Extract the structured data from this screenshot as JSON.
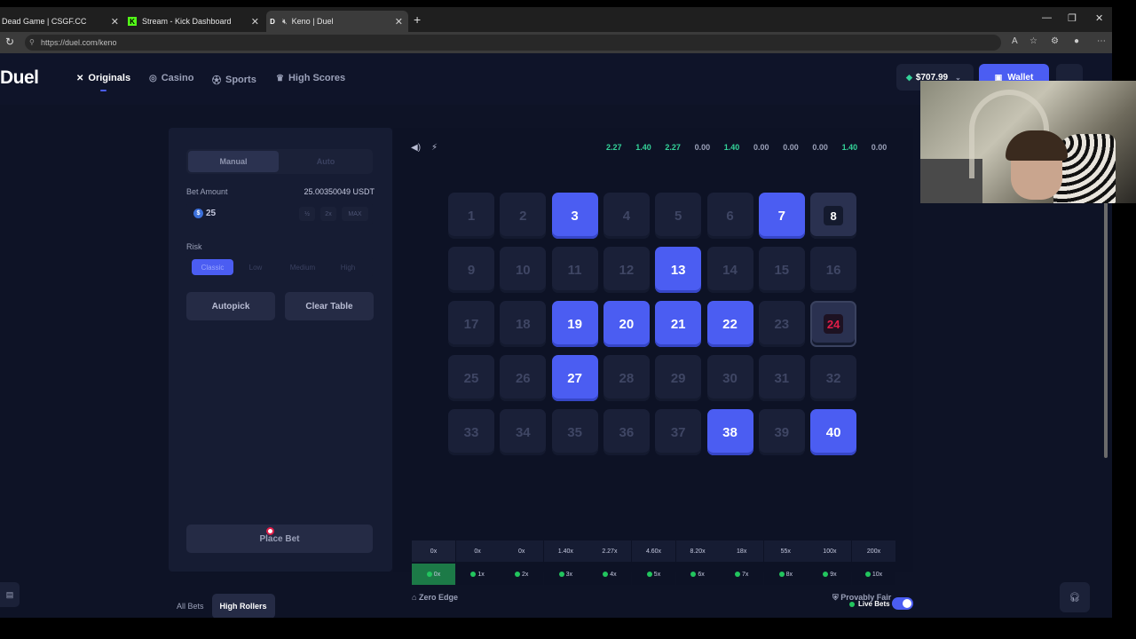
{
  "browser": {
    "tabs": [
      {
        "title": "Dead Game | CSGF.CC",
        "icon": "csgf-icon",
        "active": false
      },
      {
        "title": "Stream - Kick Dashboard",
        "icon": "kick-icon",
        "active": false
      },
      {
        "title": "Keno | Duel",
        "icon": "duel-icon",
        "active": true
      }
    ],
    "new_tab": "+",
    "url": "https://duel.com/keno"
  },
  "header": {
    "logo": "Duel",
    "nav": [
      {
        "label": "Originals",
        "icon": "originals-icon"
      },
      {
        "label": "Casino",
        "icon": "casino-icon"
      },
      {
        "label": "Sports",
        "icon": "sports-icon"
      },
      {
        "label": "High Scores",
        "icon": "trophy-icon"
      }
    ],
    "balance": "$707.99",
    "wallet_label": "Wallet"
  },
  "panel": {
    "mode_manual": "Manual",
    "mode_auto": "Auto",
    "bet_amount_label": "Bet Amount",
    "bet_amount_value": "25.00350049 USDT",
    "bet_input": "25",
    "quick_half": "½",
    "quick_double": "2x",
    "quick_max": "MAX",
    "risk_label": "Risk",
    "risk_options": [
      "Classic",
      "Low",
      "Medium",
      "High"
    ],
    "risk_selected": "Classic",
    "autopick_label": "Autopick",
    "clear_label": "Clear Table",
    "place_bet_label": "Place Bet"
  },
  "game": {
    "history": [
      "2.27",
      "1.40",
      "2.27",
      "0.00",
      "1.40",
      "0.00",
      "0.00",
      "0.00",
      "1.40",
      "0.00"
    ],
    "history_colors": [
      "#34d399",
      "#34d399",
      "#34d399",
      "#9aa0b8",
      "#34d399",
      "#9aa0b8",
      "#9aa0b8",
      "#9aa0b8",
      "#34d399",
      "#9aa0b8"
    ],
    "cells": [
      {
        "n": "1",
        "state": "idle"
      },
      {
        "n": "2",
        "state": "idle"
      },
      {
        "n": "3",
        "state": "selected"
      },
      {
        "n": "4",
        "state": "idle"
      },
      {
        "n": "5",
        "state": "idle"
      },
      {
        "n": "6",
        "state": "idle"
      },
      {
        "n": "7",
        "state": "selected"
      },
      {
        "n": "8",
        "state": "drawn"
      },
      {
        "n": "9",
        "state": "idle"
      },
      {
        "n": "10",
        "state": "idle"
      },
      {
        "n": "11",
        "state": "idle"
      },
      {
        "n": "12",
        "state": "idle"
      },
      {
        "n": "13",
        "state": "selected"
      },
      {
        "n": "14",
        "state": "idle"
      },
      {
        "n": "15",
        "state": "idle"
      },
      {
        "n": "16",
        "state": "idle"
      },
      {
        "n": "17",
        "state": "idle"
      },
      {
        "n": "18",
        "state": "idle"
      },
      {
        "n": "19",
        "state": "selected"
      },
      {
        "n": "20",
        "state": "selected"
      },
      {
        "n": "21",
        "state": "selected"
      },
      {
        "n": "22",
        "state": "selected"
      },
      {
        "n": "23",
        "state": "idle"
      },
      {
        "n": "24",
        "state": "miss"
      },
      {
        "n": "25",
        "state": "idle"
      },
      {
        "n": "26",
        "state": "idle"
      },
      {
        "n": "27",
        "state": "selected"
      },
      {
        "n": "28",
        "state": "idle"
      },
      {
        "n": "29",
        "state": "idle"
      },
      {
        "n": "30",
        "state": "idle"
      },
      {
        "n": "31",
        "state": "idle"
      },
      {
        "n": "32",
        "state": "idle"
      },
      {
        "n": "33",
        "state": "idle"
      },
      {
        "n": "34",
        "state": "idle"
      },
      {
        "n": "35",
        "state": "idle"
      },
      {
        "n": "36",
        "state": "idle"
      },
      {
        "n": "37",
        "state": "idle"
      },
      {
        "n": "38",
        "state": "selected"
      },
      {
        "n": "39",
        "state": "idle"
      },
      {
        "n": "40",
        "state": "selected"
      }
    ],
    "payouts": [
      "0x",
      "0x",
      "0x",
      "1.40x",
      "2.27x",
      "4.60x",
      "8.20x",
      "18x",
      "55x",
      "100x",
      "200x"
    ],
    "hits": [
      "0x",
      "1x",
      "2x",
      "3x",
      "4x",
      "5x",
      "6x",
      "7x",
      "8x",
      "9x",
      "10x"
    ],
    "current_hit_index": 0,
    "zero_edge": "Zero Edge",
    "provably_fair": "Provably Fair"
  },
  "bottom": {
    "tabs": [
      "All Bets",
      "High Rollers"
    ],
    "active_tab": "High Rollers",
    "live_bets": "Live Bets",
    "live_toggle": true
  },
  "colors": {
    "accent": "#4b5df2",
    "win_green": "#34d399",
    "miss_red": "#e11d48"
  }
}
